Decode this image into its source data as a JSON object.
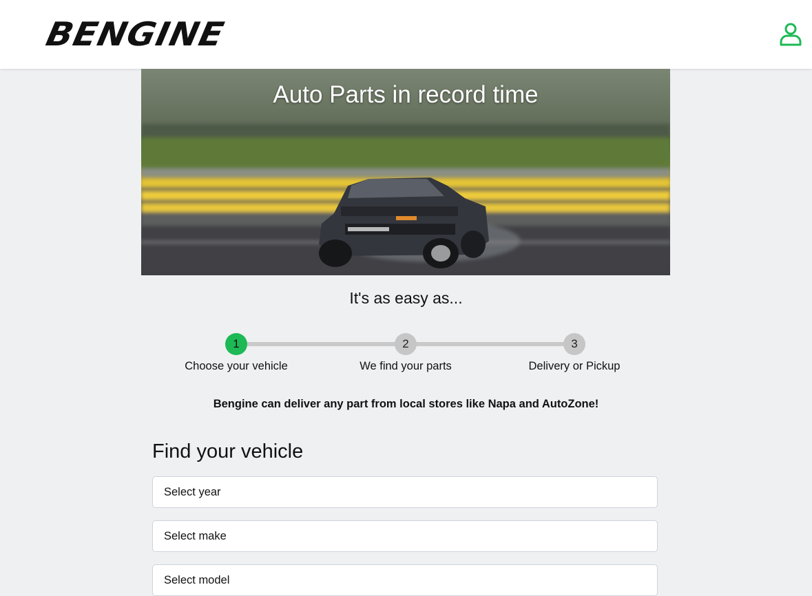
{
  "header": {
    "logo_text": "BENGINE",
    "user_icon": "user-icon",
    "accent_color": "#1cb955"
  },
  "hero": {
    "title": "Auto Parts in record time"
  },
  "steps_intro": "It's as easy as...",
  "steps": [
    {
      "number": "1",
      "label": "Choose your vehicle",
      "active": true
    },
    {
      "number": "2",
      "label": "We find your parts",
      "active": false
    },
    {
      "number": "3",
      "label": "Delivery or Pickup",
      "active": false
    }
  ],
  "tagline": "Bengine can deliver any part from local stores like Napa and AutoZone!",
  "finder": {
    "title": "Find your vehicle",
    "year_placeholder": "Select year",
    "make_placeholder": "Select make",
    "model_placeholder": "Select model"
  }
}
